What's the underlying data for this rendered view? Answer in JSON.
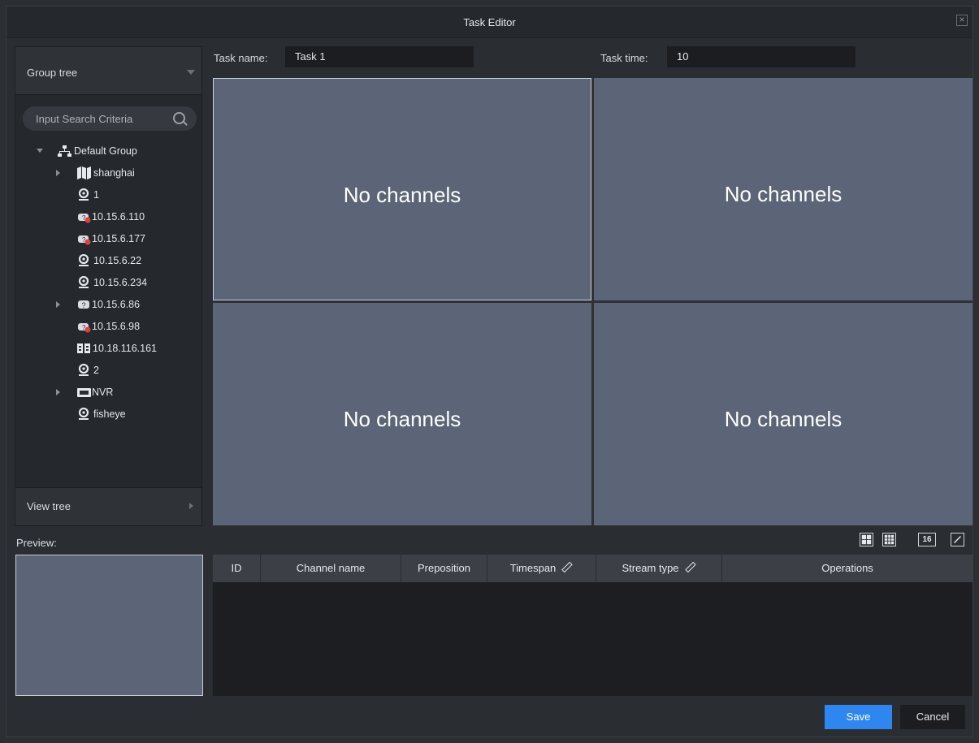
{
  "window": {
    "title": "Task Editor"
  },
  "left_panel": {
    "group_tree_label": "Group tree",
    "search_placeholder": "Input Search Criteria",
    "tree": [
      {
        "label": "Default Group",
        "icon": "group-tree-icon"
      },
      {
        "label": "shanghai",
        "icon": "map-icon"
      },
      {
        "label": "1",
        "icon": "camera-icon"
      },
      {
        "label": "10.15.6.110",
        "icon": "offline-camera-icon"
      },
      {
        "label": "10.15.6.177",
        "icon": "offline-camera-icon"
      },
      {
        "label": "10.15.6.22",
        "icon": "camera-icon"
      },
      {
        "label": "10.15.6.234",
        "icon": "camera-icon"
      },
      {
        "label": "10.15.6.86",
        "icon": "unknown-device-icon"
      },
      {
        "label": "10.15.6.98",
        "icon": "offline-camera-icon"
      },
      {
        "label": "10.18.116.161",
        "icon": "encoder-icon"
      },
      {
        "label": "2",
        "icon": "camera-icon"
      },
      {
        "label": "NVR",
        "icon": "nvr-icon"
      },
      {
        "label": "fisheye",
        "icon": "camera-icon"
      }
    ],
    "view_tree_label": "View tree"
  },
  "preview_label": "Preview:",
  "task": {
    "name_label": "Task name:",
    "name_value": "Task 1",
    "time_label": "Task time:",
    "time_value": "10"
  },
  "grid": {
    "cells": [
      "No channels",
      "No channels",
      "No channels",
      "No channels"
    ]
  },
  "layout_tools": [
    "four-pane-layout-icon",
    "nine-pane-layout-icon",
    "sixteen-pane-layout-icon",
    "custom-layout-icon"
  ],
  "layout_tools_labels": {
    "sixteen": "16"
  },
  "table": {
    "columns": [
      "ID",
      "Channel name",
      "Preposition",
      "Timespan",
      "Stream type",
      "Operations"
    ]
  },
  "buttons": {
    "save": "Save",
    "cancel": "Cancel"
  },
  "colors": {
    "accent": "#2e87f0",
    "cell_bg": "#5b6577",
    "window_bg": "#2a2d32"
  }
}
